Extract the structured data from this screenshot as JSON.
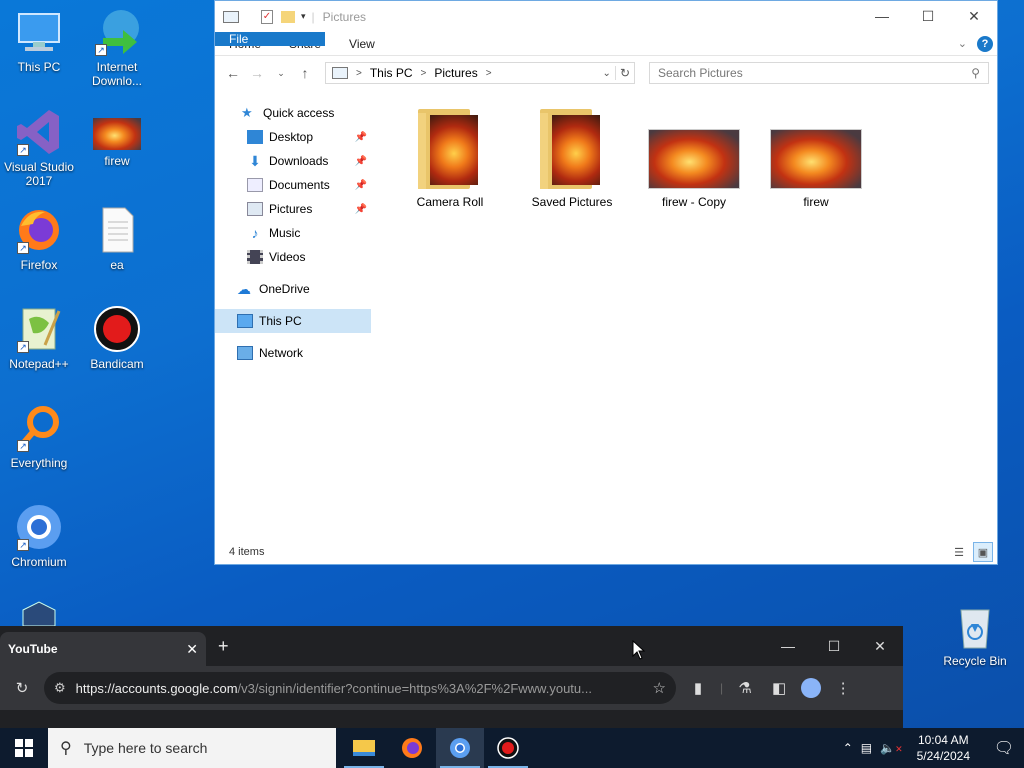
{
  "desktop": {
    "icons": [
      {
        "label": "This PC"
      },
      {
        "label": "Internet Downlo..."
      },
      {
        "label": "Visual Studio 2017"
      },
      {
        "label": "firew"
      },
      {
        "label": "Firefox"
      },
      {
        "label": "ea"
      },
      {
        "label": "Notepad++"
      },
      {
        "label": "Bandicam"
      },
      {
        "label": "Everything"
      },
      {
        "label": "Chromium"
      },
      {
        "label": "Recycle Bin"
      }
    ]
  },
  "explorer": {
    "title": "Pictures",
    "ribbon_tabs": [
      "File",
      "Home",
      "Share",
      "View"
    ],
    "address": {
      "crumbs": [
        "This PC",
        "Pictures"
      ]
    },
    "search_placeholder": "Search Pictures",
    "nav": [
      {
        "label": "Quick access"
      },
      {
        "label": "Desktop",
        "pinned": true
      },
      {
        "label": "Downloads",
        "pinned": true
      },
      {
        "label": "Documents",
        "pinned": true
      },
      {
        "label": "Pictures",
        "pinned": true
      },
      {
        "label": "Music"
      },
      {
        "label": "Videos"
      },
      {
        "label": "OneDrive"
      },
      {
        "label": "This PC",
        "selected": true
      },
      {
        "label": "Network"
      }
    ],
    "items": [
      {
        "name": "Camera Roll",
        "type": "folder"
      },
      {
        "name": "Saved Pictures",
        "type": "folder"
      },
      {
        "name": "firew - Copy",
        "type": "image"
      },
      {
        "name": "firew",
        "type": "image"
      }
    ],
    "status": "4 items"
  },
  "chromium": {
    "tab_title": "YouTube",
    "url_host": "https://accounts.google.com",
    "url_path": "/v3/signin/identifier?continue=https%3A%2F%2Fwww.youtu..."
  },
  "taskbar": {
    "search_placeholder": "Type here to search",
    "time": "10:04 AM",
    "date": "5/24/2024"
  },
  "colors": {
    "accent": "#1979ca",
    "desktop": "#0a6fd0",
    "chrome_bg": "#202124"
  }
}
